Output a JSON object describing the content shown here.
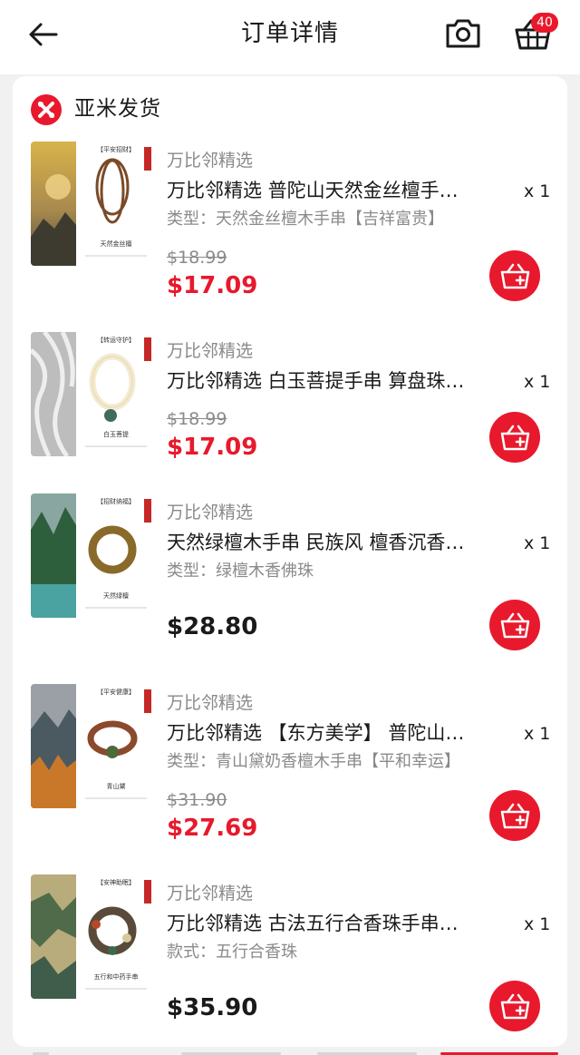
{
  "header": {
    "title": "订单详情",
    "back_icon": "arrow-left-icon",
    "camera_icon": "camera-icon",
    "cart_icon": "shopping-basket-icon",
    "cart_count": "40"
  },
  "seller": {
    "name": "亚米发货",
    "logo_icon": "yami-logo-icon"
  },
  "items": [
    {
      "store": "万比邻精选",
      "title": "万比邻精选 普陀山天然金丝檀手…",
      "qty": "x 1",
      "variant": "类型：天然金丝檀木手串【吉祥富贵】",
      "original_price": "$18.99",
      "price": "$17.09",
      "on_sale": true,
      "thumb_tag": "【平安招财】",
      "thumb_name": "天然金丝檀"
    },
    {
      "store": "万比邻精选",
      "title": "万比邻精选 白玉菩提手串 算盘珠…",
      "qty": "x 1",
      "variant": "",
      "original_price": "$18.99",
      "price": "$17.09",
      "on_sale": true,
      "thumb_tag": "【转运守护】",
      "thumb_name": "白玉菩提"
    },
    {
      "store": "万比邻精选",
      "title": "天然绿檀木手串 民族风 檀香沉香…",
      "qty": "x 1",
      "variant": "类型：绿檀木香佛珠",
      "original_price": "",
      "price": "$28.80",
      "on_sale": false,
      "thumb_tag": "【招财纳福】",
      "thumb_name": "天然绿檀"
    },
    {
      "store": "万比邻精选",
      "title": "万比邻精选 【东方美学】 普陀山…",
      "qty": "x 1",
      "variant": "类型：青山黛奶香檀木手串【平和幸运】",
      "original_price": "$31.90",
      "price": "$27.69",
      "on_sale": true,
      "thumb_tag": "【平安健康】",
      "thumb_name": "青山黛"
    },
    {
      "store": "万比邻精选",
      "title": "万比邻精选 古法五行合香珠手串…",
      "qty": "x 1",
      "variant": "款式：五行合香珠",
      "original_price": "",
      "price": "$35.90",
      "on_sale": false,
      "thumb_tag": "【安神助眠】",
      "thumb_name": "五行和中药手串"
    }
  ],
  "add_to_cart_icon": "add-to-cart-icon",
  "colors": {
    "accent": "#e8192c",
    "muted_text": "#8a8a8a",
    "primary_text": "#1a1a1a",
    "background": "#f1f1f1"
  }
}
